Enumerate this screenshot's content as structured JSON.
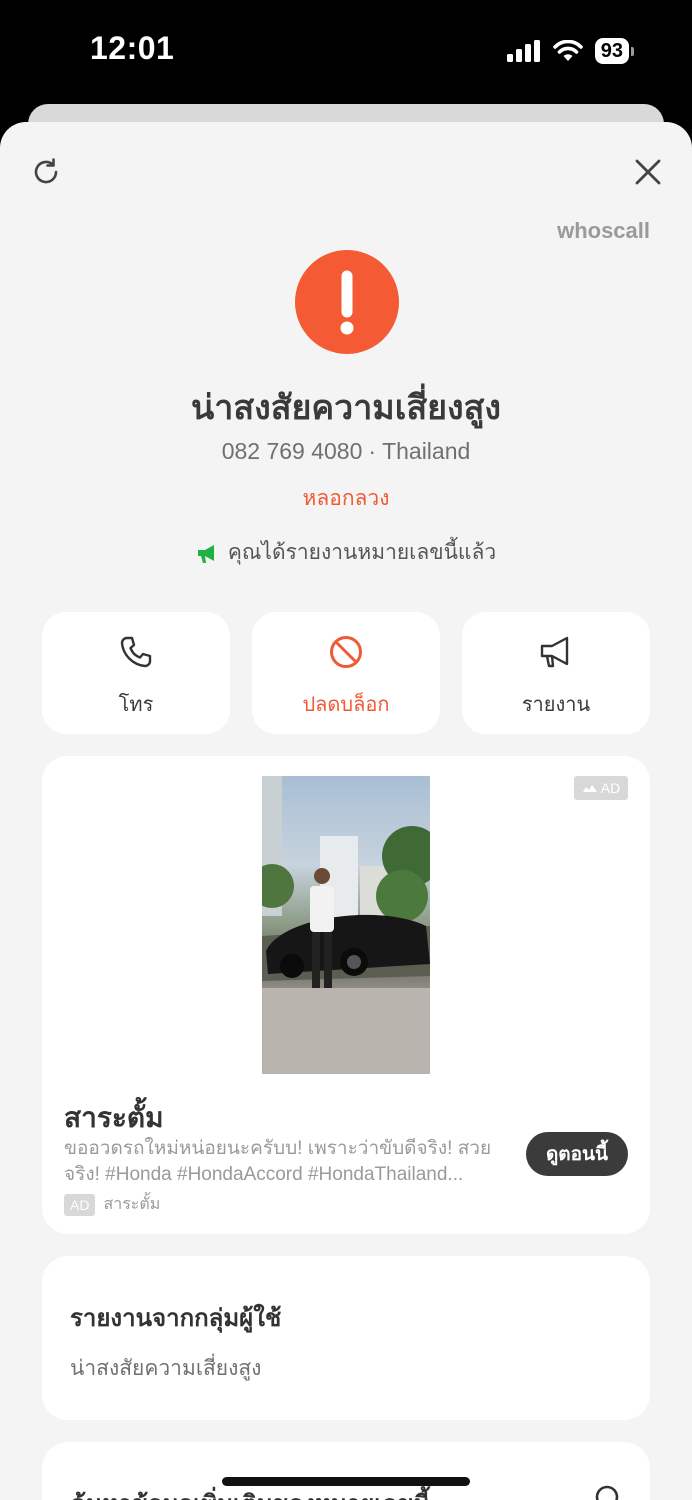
{
  "status_bar": {
    "time": "12:01",
    "battery": "93"
  },
  "header": {
    "brand": "whoscall"
  },
  "caller": {
    "risk_title": "น่าสงสัยความเสี่ยงสูง",
    "number": "082 769 4080",
    "separator": "·",
    "country": "Thailand",
    "category": "หลอกลวง",
    "reported_text": "คุณได้รายงานหมายเลขนี้แล้ว"
  },
  "actions": [
    {
      "label": "โทร",
      "icon": "phone-icon"
    },
    {
      "label": "ปลดบล็อก",
      "icon": "block-icon"
    },
    {
      "label": "รายงาน",
      "icon": "megaphone-icon"
    }
  ],
  "ad": {
    "badge": "AD",
    "title": "สาระตั้ม",
    "description": "ขออวดรถใหม่หน่อยนะครับบ! เพราะว่าขับดีจริง! สวยจริง!  #Honda #HondaAccord #HondaThailand...",
    "tag": "AD",
    "sponsor": "สาระตั้ม",
    "cta": "ดูตอนนี้"
  },
  "community_report": {
    "title": "รายงานจากกลุ่มผู้ใช้",
    "value": "น่าสงสัยความเสี่ยงสูง"
  },
  "more_info": {
    "title": "ค้นหาข้อมูลเพิ่มเติมของหมายเลขนี้"
  },
  "colors": {
    "accent": "#f45a33",
    "report_green": "#1fb141",
    "card_bg": "#ffffff",
    "sheet_bg": "#f4f4f4"
  }
}
